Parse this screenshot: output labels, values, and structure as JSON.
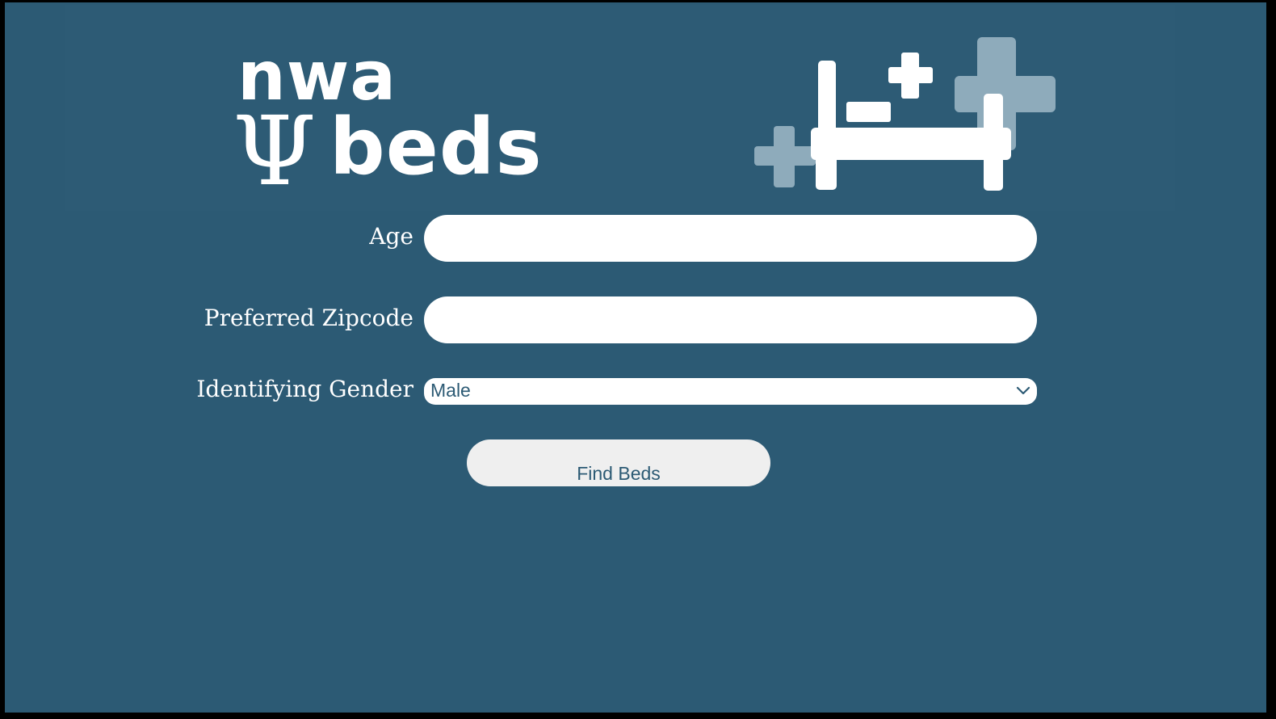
{
  "logo": {
    "line1": "nwa",
    "psi_symbol": "Ψ",
    "line2": "beds",
    "bed_icon": "hospital-bed-icon"
  },
  "form": {
    "age_label": "Age",
    "age_value": "",
    "zipcode_label": "Preferred Zipcode",
    "zipcode_value": "",
    "gender_label": "Identifying Gender",
    "gender_selected": "Male",
    "submit_label": "Find Beds"
  },
  "colors": {
    "background": "#2c5a74",
    "accent_light": "#8eabbb",
    "text_on_dark": "#ffffff",
    "button_bg": "#efefef"
  }
}
